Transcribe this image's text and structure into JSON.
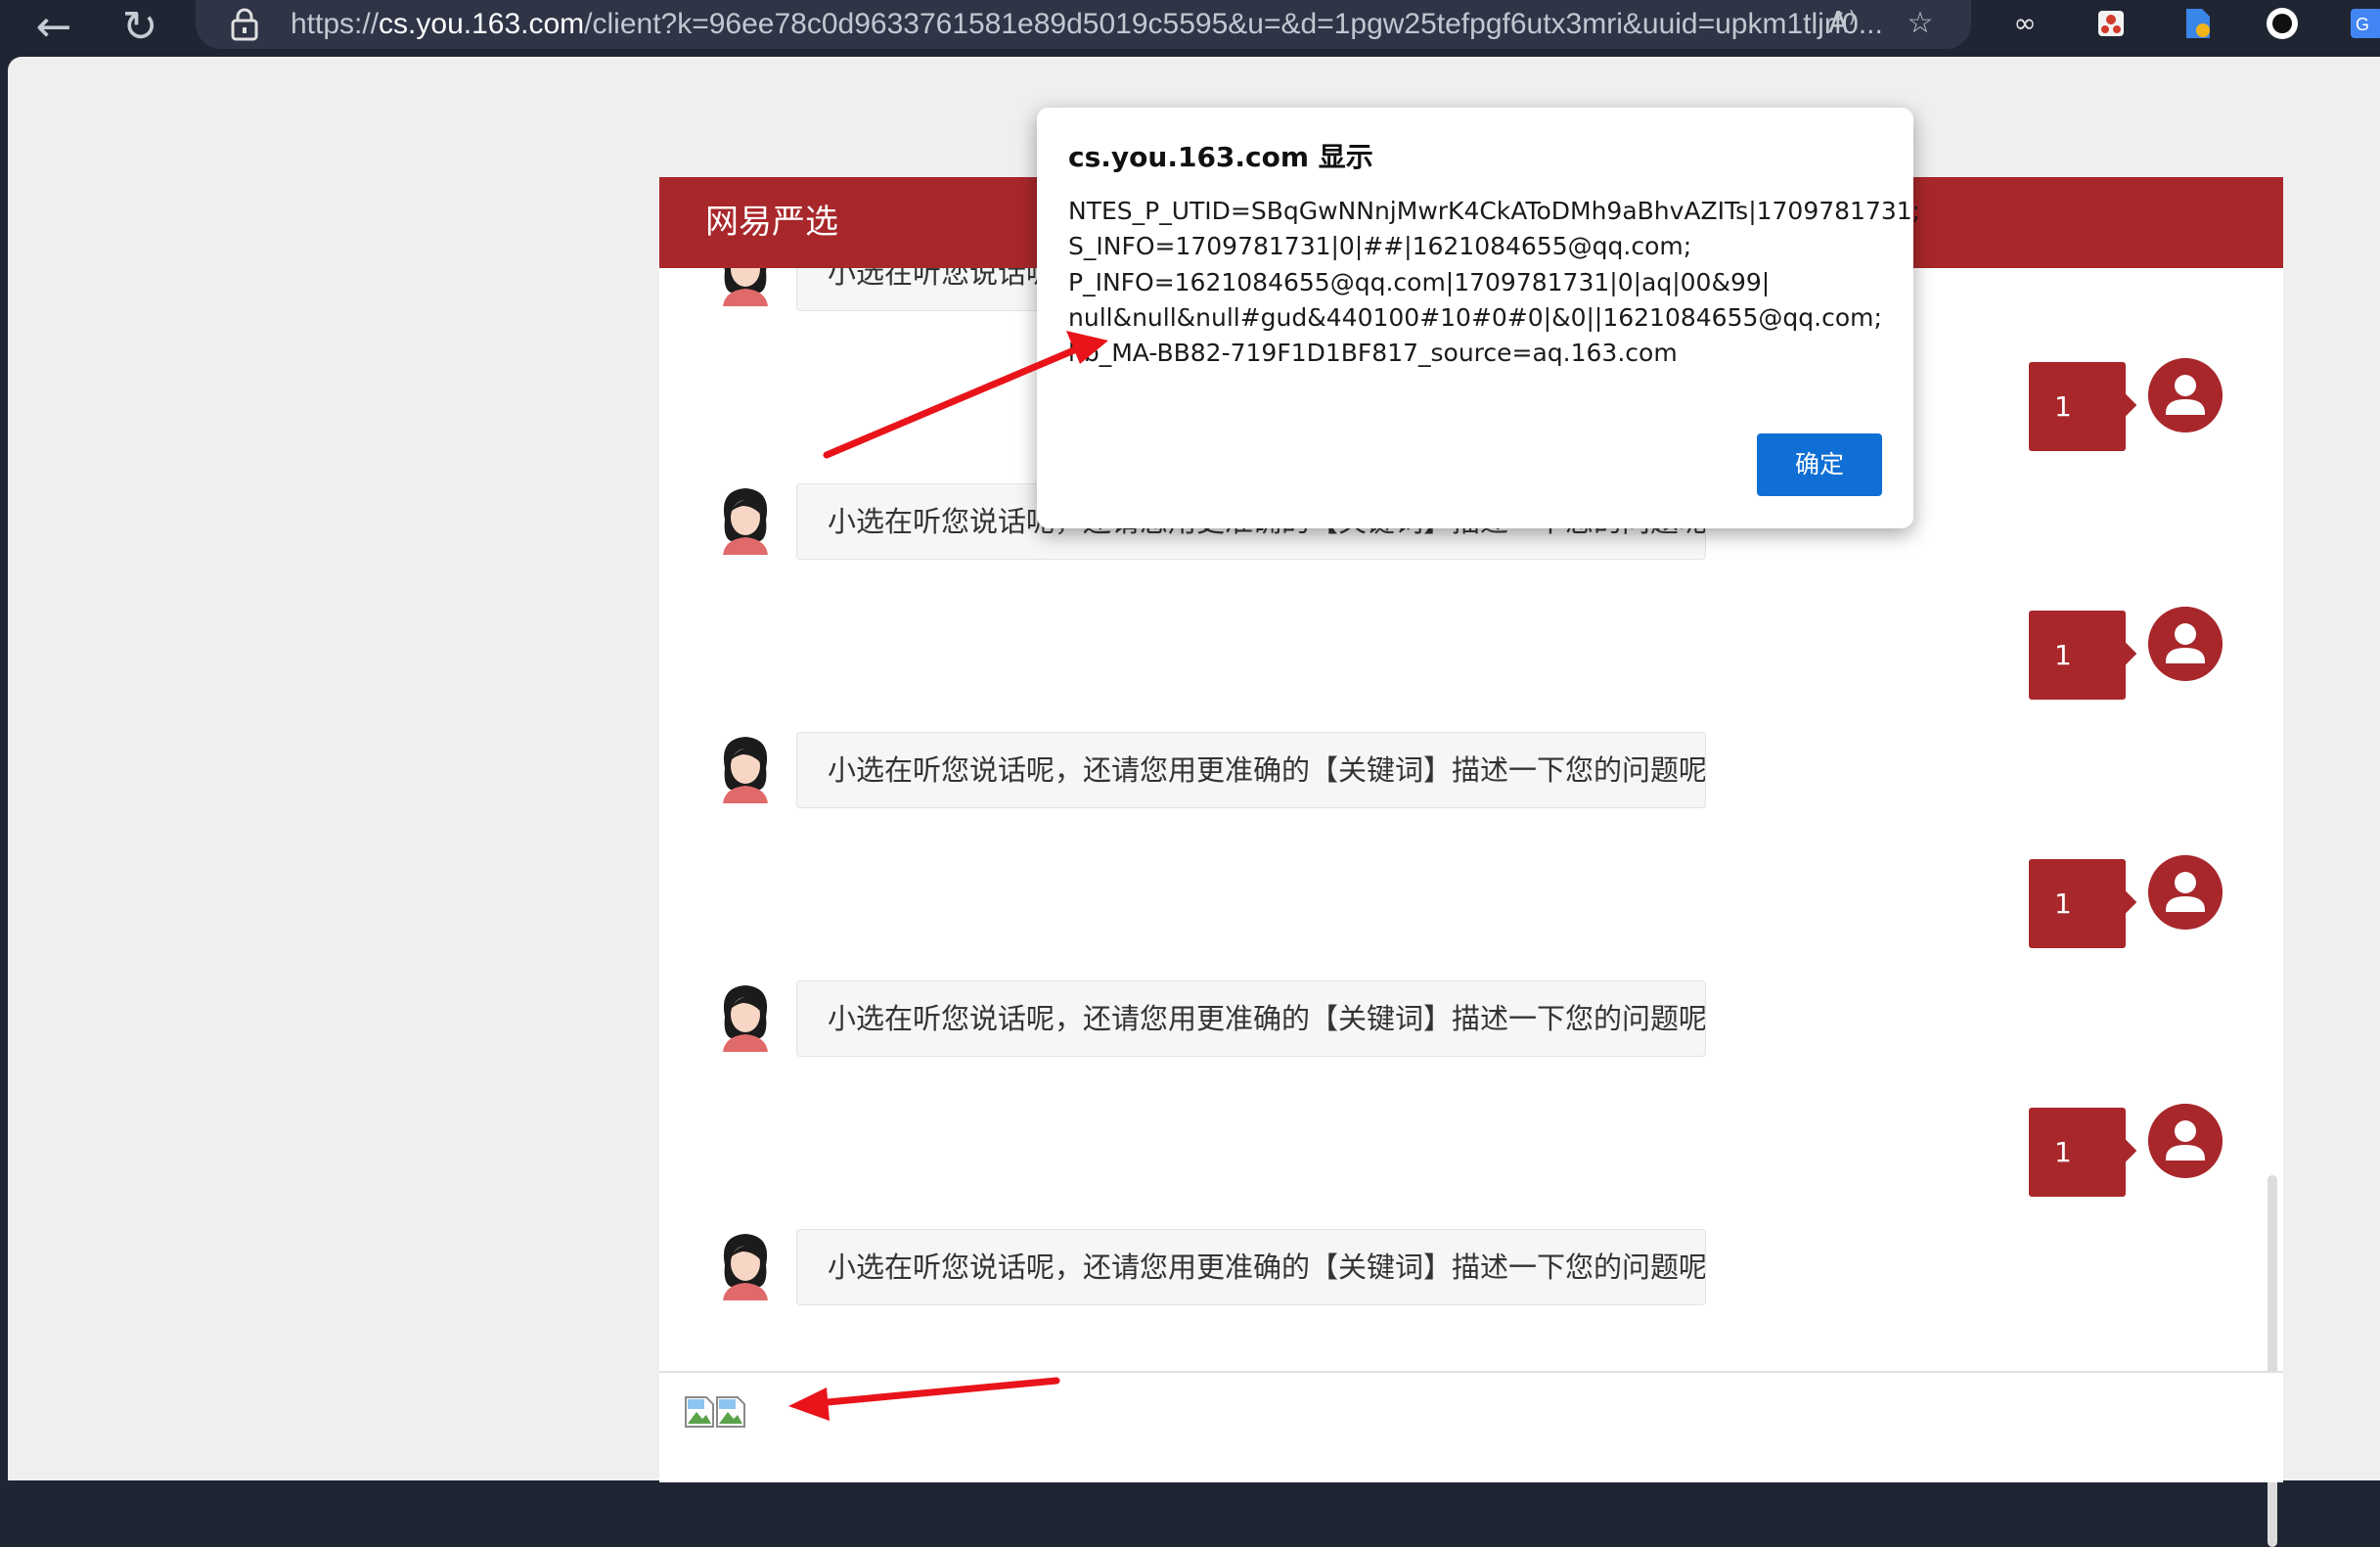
{
  "browser": {
    "url_prefix": "https://",
    "url_host": "cs.you.163.com",
    "url_rest": "/client?k=96ee78c0d9633761581e89d5019c5595&u=&d=1pgw25tefpgf6utx3mri&uuid=upkm1tljrf0..."
  },
  "chat": {
    "title": "网易严选",
    "bot_message": "小选在听您说话呢，还请您用更准确的【关键词】描述一下您的问题呢",
    "bot_message_partial": "小选在听您说话呢",
    "user_message": "1"
  },
  "dialog": {
    "title": "cs.you.163.com 显示",
    "lines": [
      "NTES_P_UTID=SBqGwNNnjMwrK4CkAToDMh9aBhvAZITs|1709781731;",
      "S_INFO=1709781731|0|##|1621084655@qq.com;",
      "P_INFO=1621084655@qq.com|1709781731|0|aq|00&99|",
      "null&null&null#gud&440100#10#0#0|&0||1621084655@qq.com;",
      "hb_MA-BB82-719F1D1BF817_source=aq.163.com"
    ],
    "ok_label": "确定"
  },
  "colors": {
    "brand_red": "#a8272b",
    "dialog_button": "#0f6fd5",
    "annotation_arrow": "#e8141a"
  }
}
